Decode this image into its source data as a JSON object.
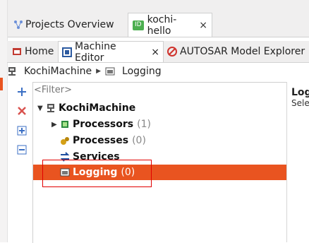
{
  "editor_tabs": [
    {
      "label": "Projects Overview"
    },
    {
      "label": "kochi-hello",
      "close": "×"
    }
  ],
  "view_tabs": [
    {
      "label": "Home"
    },
    {
      "label": "Machine Editor",
      "close": "×"
    },
    {
      "label": "AUTOSAR Model Explorer"
    }
  ],
  "breadcrumb": [
    {
      "label": "KochiMachine"
    },
    {
      "label": "Logging"
    }
  ],
  "filter": {
    "placeholder": "<Filter>"
  },
  "tree": {
    "root": {
      "label": "KochiMachine"
    },
    "items": [
      {
        "label": "Processors",
        "count": "(1)"
      },
      {
        "label": "Processes",
        "count": "(0)"
      },
      {
        "label": "Services",
        "count": ""
      },
      {
        "label": "Logging",
        "count": "(0)",
        "selected": true
      }
    ]
  },
  "details": {
    "title": "Log",
    "subtitle": "Selec"
  },
  "colors": {
    "selection": "#e95420",
    "highlight_box": "#e20000"
  }
}
